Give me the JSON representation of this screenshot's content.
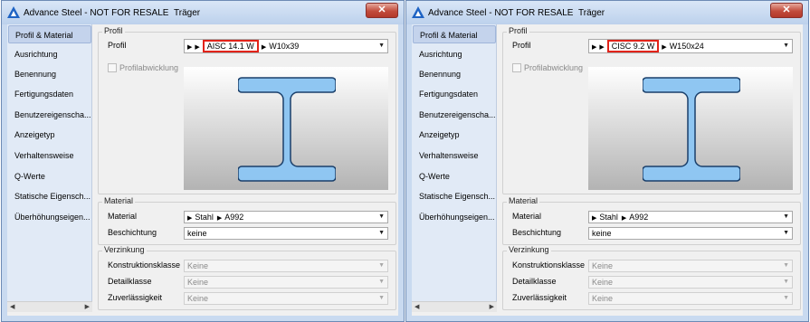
{
  "windows": [
    {
      "title": "Advance Steel - NOT FOR RESALE",
      "subtitle": "Träger",
      "close_glyph": "✕",
      "sidebar": [
        "Profil & Material",
        "Ausrichtung",
        "Benennung",
        "Fertigungsdaten",
        "Benutzereigenscha...",
        "Anzeigetyp",
        "Verhaltensweise",
        "Q-Werte",
        "Statische Eigensch...",
        "Überhöhungseigen..."
      ],
      "profil_group": "Profil",
      "profil_label": "Profil",
      "profil_standard": "AISC 14.1 W",
      "profil_section": "W10x39",
      "profilabwicklung": "Profilabwicklung",
      "material_group": "Material",
      "material_label": "Material",
      "material_type": "Stahl",
      "material_grade": "A992",
      "beschichtung_label": "Beschichtung",
      "beschichtung_value": "keine",
      "verzinkung_group": "Verzinkung",
      "konstruktionsklasse_label": "Konstruktionsklasse",
      "konstruktionsklasse_value": "Keine",
      "detailklasse_label": "Detailklasse",
      "detailklasse_value": "Keine",
      "zuverlaessigkeit_label": "Zuverlässigkeit",
      "zuverlaessigkeit_value": "Keine"
    },
    {
      "title": "Advance Steel - NOT FOR RESALE",
      "subtitle": "Träger",
      "close_glyph": "✕",
      "sidebar": [
        "Profil & Material",
        "Ausrichtung",
        "Benennung",
        "Fertigungsdaten",
        "Benutzereigenscha...",
        "Anzeigetyp",
        "Verhaltensweise",
        "Q-Werte",
        "Statische Eigensch...",
        "Überhöhungseigen..."
      ],
      "profil_group": "Profil",
      "profil_label": "Profil",
      "profil_standard": "CISC 9.2 W",
      "profil_section": "W150x24",
      "profilabwicklung": "Profilabwicklung",
      "material_group": "Material",
      "material_label": "Material",
      "material_type": "Stahl",
      "material_grade": "A992",
      "beschichtung_label": "Beschichtung",
      "beschichtung_value": "keine",
      "verzinkung_group": "Verzinkung",
      "konstruktionsklasse_label": "Konstruktionsklasse",
      "konstruktionsklasse_value": "Keine",
      "detailklasse_label": "Detailklasse",
      "detailklasse_value": "Keine",
      "zuverlaessigkeit_label": "Zuverlässigkeit",
      "zuverlaessigkeit_value": "Keine"
    }
  ],
  "colors": {
    "window_frame": "#c9daf0",
    "sidebar_bg": "#e1eaf6",
    "sidebar_selected": "#c4d3ec",
    "highlight_border": "#e2231a",
    "beam_fill": "#8fc6f2",
    "close_button": "#c24c3c"
  },
  "icons": {
    "title": "advance-steel-logo-icon",
    "close": "close-icon",
    "dropdown": "chevron-down-icon",
    "breadcrumb": "triangle-right-icon"
  }
}
